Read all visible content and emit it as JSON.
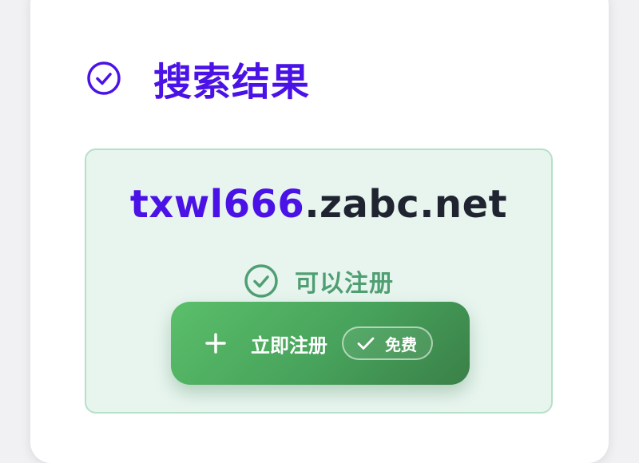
{
  "header": {
    "title": "搜索结果",
    "icon": "check-circle-icon"
  },
  "result": {
    "domain_name": "txwl666",
    "domain_suffix": ".zabc.net",
    "status_text": "可以注册",
    "status_icon": "check-circle-icon",
    "register_button": {
      "label": "立即注册",
      "icon": "plus-icon",
      "badge_label": "免费",
      "badge_icon": "check-icon"
    }
  },
  "colors": {
    "accent": "#4a12e6",
    "success": "#4f9f73",
    "button_start": "#5abf6a",
    "button_end": "#3a8048",
    "result_bg": "#e8f5ef"
  }
}
